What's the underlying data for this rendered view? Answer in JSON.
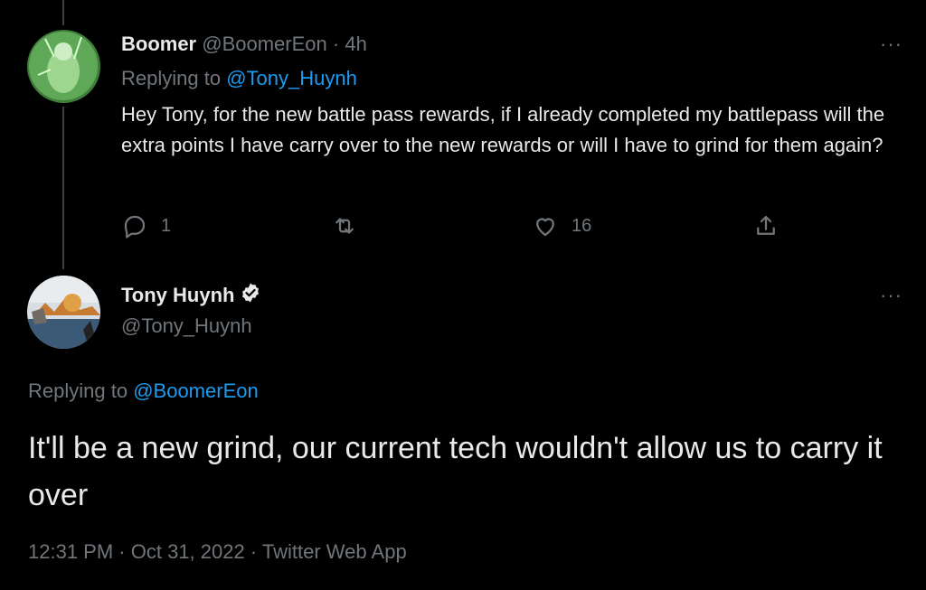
{
  "reply_tweet": {
    "author_name": "Boomer",
    "author_handle": "@BoomerEon",
    "separator": "·",
    "time_ago": "4h",
    "replying_prefix": "Replying to",
    "replying_to": "@Tony_Huynh",
    "body": "Hey Tony, for the new battle pass rewards, if I already completed my battlepass will the extra points I have carry over to the new rewards or will I have to grind for them again?",
    "reply_count": "1",
    "like_count": "16",
    "more_label": "···"
  },
  "main_tweet": {
    "author_name": "Tony Huynh",
    "author_handle": "@Tony_Huynh",
    "replying_prefix": "Replying to",
    "replying_to": "@BoomerEon",
    "body": "It'll be a new grind, our current tech wouldn't allow us to carry it over",
    "time": "12:31 PM",
    "sep1": "·",
    "date": "Oct 31, 2022",
    "sep2": "·",
    "source": "Twitter Web App",
    "more_label": "···"
  },
  "colors": {
    "background": "#000000",
    "text": "#e7e9ea",
    "muted": "#71767b",
    "link": "#1d9bf0"
  },
  "icons": [
    "reply-icon",
    "retweet-icon",
    "like-icon",
    "share-icon",
    "verified-badge-icon",
    "more-icon"
  ]
}
